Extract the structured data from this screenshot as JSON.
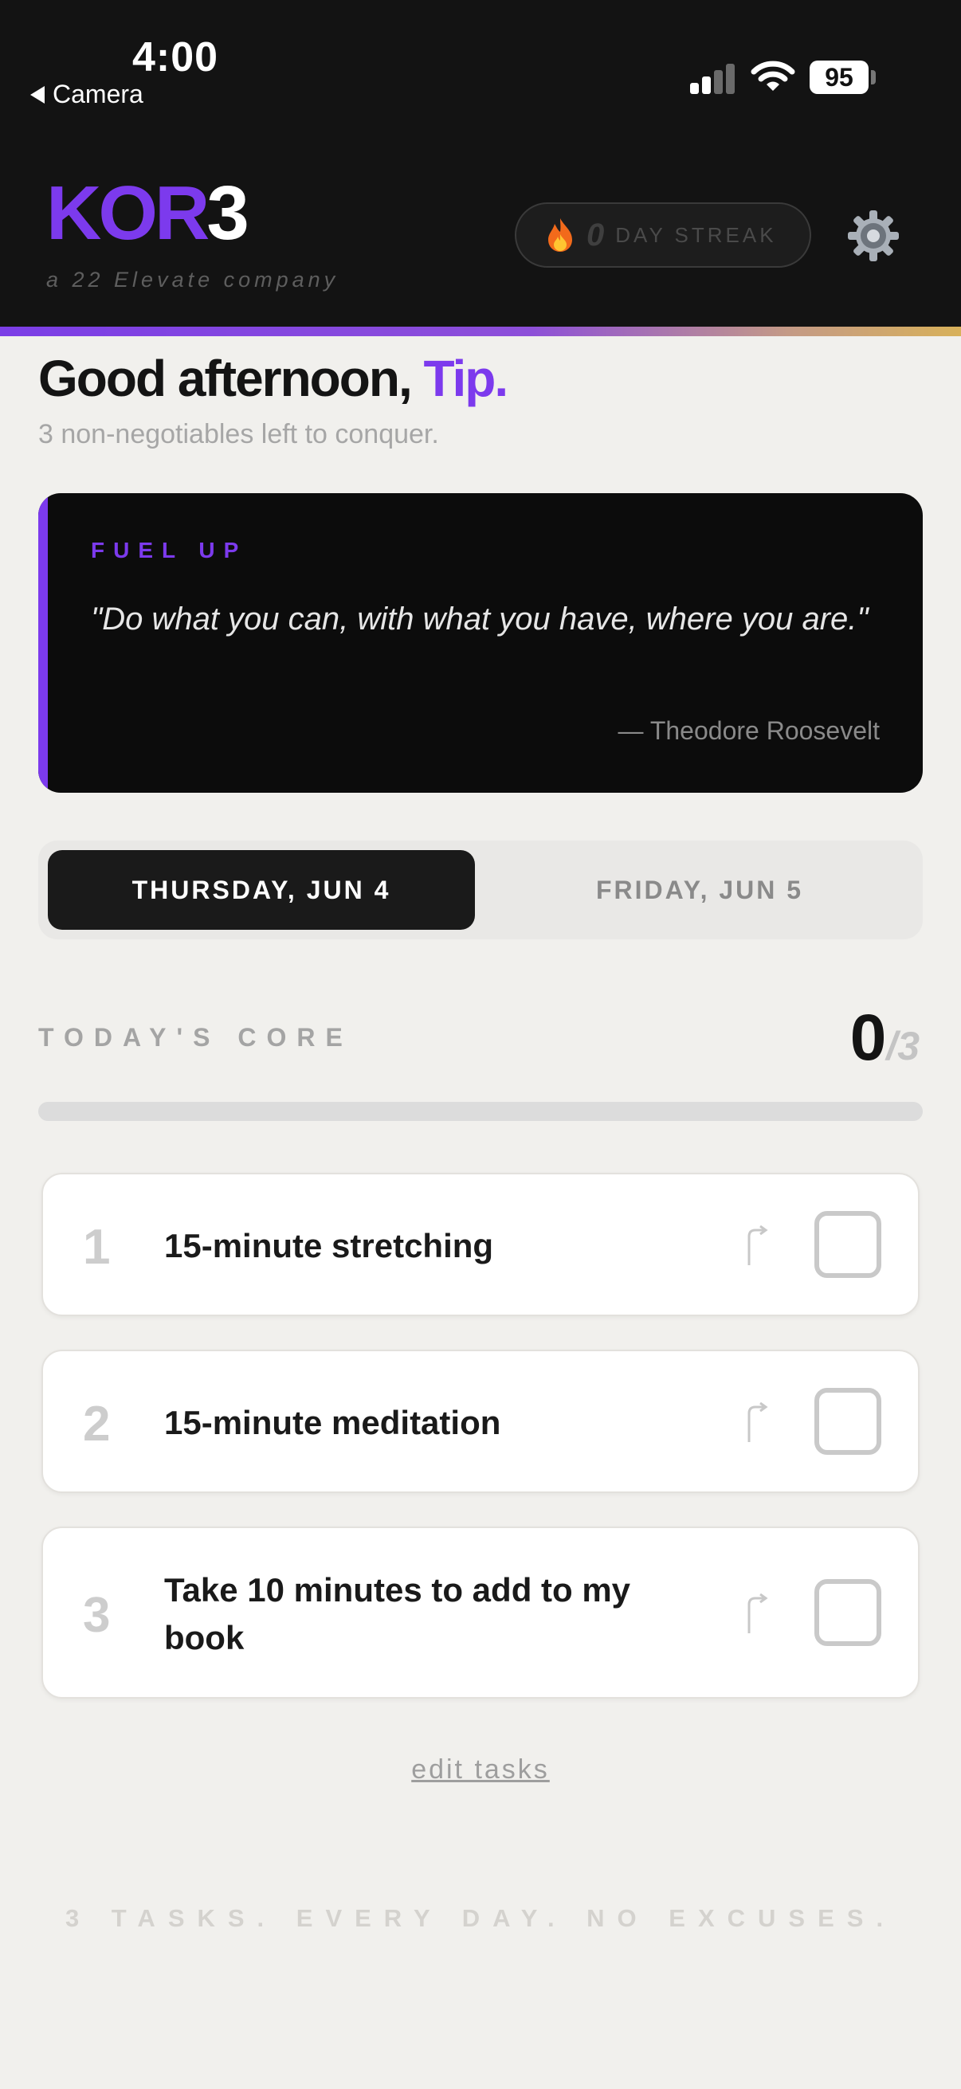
{
  "status_bar": {
    "time": "4:00",
    "back_label": "Camera",
    "battery": "95"
  },
  "header": {
    "logo_part1": "KOR",
    "logo_part2": "3",
    "tagline": "a 22 Elevate company",
    "streak_count": "0",
    "streak_label": "DAY STREAK",
    "settings_icon": "gear-icon",
    "accent_color": "#7c3aed"
  },
  "greeting": {
    "prefix": "Good afternoon, ",
    "name": "Tip.",
    "subtitle": "3 non-negotiables left to conquer."
  },
  "quote": {
    "kicker": "FUEL UP",
    "text": "\"Do what you can, with what you have, where you are.\"",
    "author": "— Theodore Roosevelt"
  },
  "day_tabs": [
    {
      "label": "THURSDAY, JUN 4",
      "active": true
    },
    {
      "label": "FRIDAY, JUN 5",
      "active": false
    }
  ],
  "core": {
    "label": "TODAY'S CORE",
    "done": "0",
    "total": "/3",
    "progress": 0
  },
  "tasks": [
    {
      "number": "1",
      "text": "15-minute stretching",
      "checked": false
    },
    {
      "number": "2",
      "text": "15-minute meditation",
      "checked": false
    },
    {
      "number": "3",
      "text": "Take 10 minutes to add to my book",
      "checked": false
    }
  ],
  "edit_link": "edit tasks",
  "footer_motto": "3 TASKS. EVERY DAY. NO EXCUSES."
}
